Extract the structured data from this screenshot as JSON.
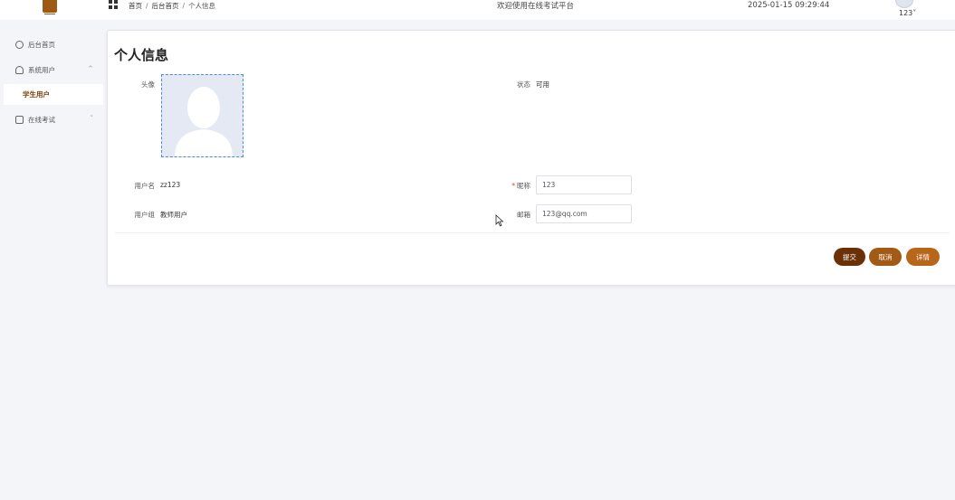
{
  "header": {
    "breadcrumb": [
      "首页",
      "后台首页",
      "个人信息"
    ],
    "welcome": "欢迎使用在线考试平台",
    "datetime": "2025-01-15 09:29:44",
    "user": "123"
  },
  "sidebar": {
    "items": [
      {
        "label": "后台首页",
        "icon": "dashboard-icon"
      },
      {
        "label": "系统用户",
        "icon": "user-icon",
        "expanded": true,
        "children": [
          "学生用户"
        ]
      },
      {
        "label": "在线考试",
        "icon": "exam-icon",
        "expanded": false
      }
    ]
  },
  "page": {
    "title": "个人信息",
    "fields": {
      "avatar_label": "头像",
      "status_label": "状态",
      "status_value": "可用",
      "username_label": "用户名",
      "username_value": "zz123",
      "nickname_label": "昵称",
      "nickname_value": "123",
      "group_label": "用户组",
      "group_value": "教师用户",
      "email_label": "邮箱",
      "email_value": "123@qq.com"
    },
    "buttons": {
      "submit": "提交",
      "cancel": "取消",
      "detail": "详情"
    }
  },
  "colors": {
    "accent": "#6b3106",
    "accent2": "#a25a14",
    "accent3": "#b8661a",
    "active_menu_text": "#7a3e0a"
  }
}
